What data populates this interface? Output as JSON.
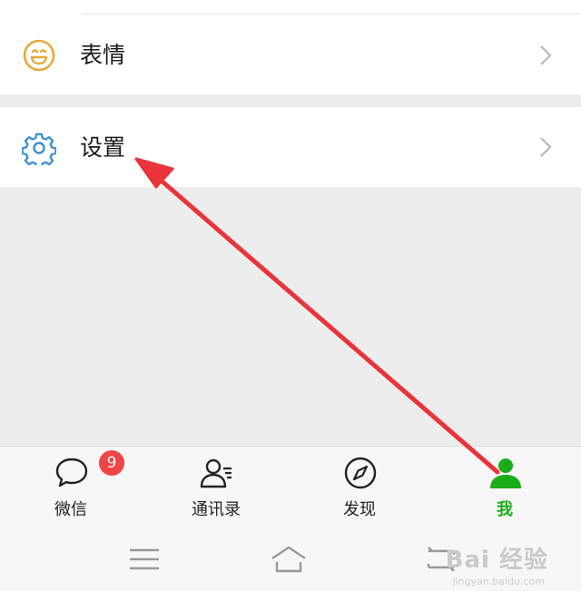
{
  "menu": {
    "items": [
      {
        "label": "表情",
        "icon": "smile-icon"
      },
      {
        "label": "设置",
        "icon": "gear-icon"
      }
    ]
  },
  "tabbar": {
    "tabs": [
      {
        "label": "微信",
        "icon": "chat-bubble-icon",
        "badge": "9"
      },
      {
        "label": "通讯录",
        "icon": "contacts-icon"
      },
      {
        "label": "发现",
        "icon": "compass-icon"
      },
      {
        "label": "我",
        "icon": "person-icon",
        "active": true
      }
    ]
  },
  "system_nav": {
    "buttons": [
      "menu-icon",
      "home-icon",
      "back-icon"
    ]
  },
  "watermark": {
    "text": "Bai 经验",
    "sub": "jingyan.baidu.com"
  },
  "colors": {
    "accent_green": "#1aad19",
    "badge_red": "#f04545",
    "emoji_icon": "#e8a93a",
    "gear_icon": "#3a8fd8",
    "annotation_arrow": "#e8343a"
  }
}
